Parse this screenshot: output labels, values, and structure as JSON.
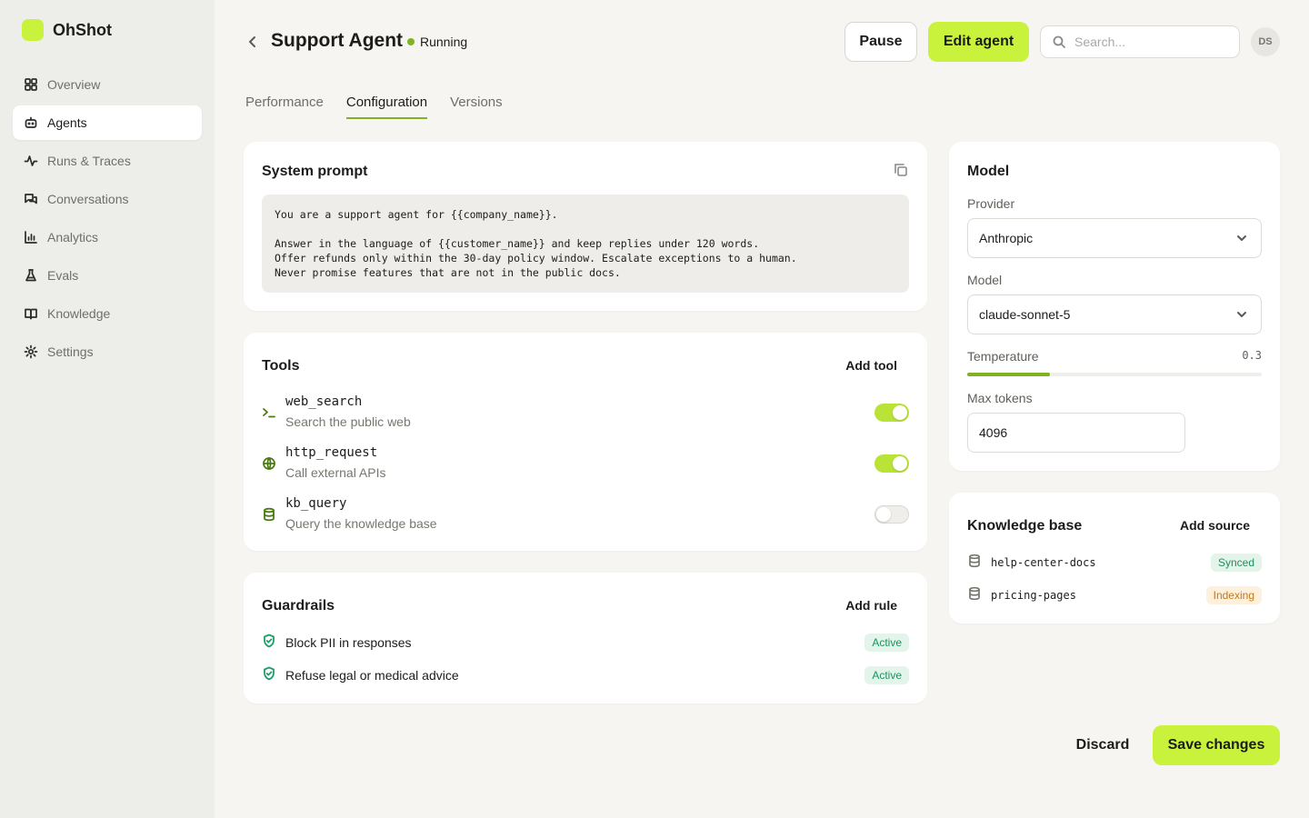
{
  "app": {
    "name": "OhShot"
  },
  "sidebar": {
    "items": [
      {
        "label": "Overview",
        "icon": "grid-icon",
        "active": false
      },
      {
        "label": "Agents",
        "icon": "bot-icon",
        "active": true
      },
      {
        "label": "Runs & Traces",
        "icon": "activity-icon",
        "active": false
      },
      {
        "label": "Conversations",
        "icon": "chat-icon",
        "active": false
      },
      {
        "label": "Analytics",
        "icon": "bar-chart-icon",
        "active": false
      },
      {
        "label": "Evals",
        "icon": "flask-icon",
        "active": false
      },
      {
        "label": "Knowledge",
        "icon": "book-icon",
        "active": false
      },
      {
        "label": "Settings",
        "icon": "gear-icon",
        "active": false
      }
    ]
  },
  "header": {
    "title": "Support Agent",
    "status": "Running",
    "pause_label": "Pause",
    "edit_label": "Edit agent",
    "search_placeholder": "Search...",
    "avatar_initials": "DS"
  },
  "tabs": [
    {
      "label": "Performance",
      "active": false
    },
    {
      "label": "Configuration",
      "active": true
    },
    {
      "label": "Versions",
      "active": false
    }
  ],
  "system_prompt": {
    "title": "System prompt",
    "lines": [
      "You are a support agent for {{company_name}}.",
      "",
      "Answer in the language of {{customer_name}} and keep replies under 120 words.",
      "Offer refunds only within the 30-day policy window. Escalate exceptions to a human.",
      "Never promise features that are not in the public docs."
    ]
  },
  "tools": {
    "title": "Tools",
    "add_label": "Add tool",
    "items": [
      {
        "name": "web_search",
        "description": "Search the public web",
        "icon": "terminal-icon",
        "enabled": true
      },
      {
        "name": "http_request",
        "description": "Call external APIs",
        "icon": "globe-icon",
        "enabled": true
      },
      {
        "name": "kb_query",
        "description": "Query the knowledge base",
        "icon": "database-icon",
        "enabled": false
      }
    ]
  },
  "guardrails": {
    "title": "Guardrails",
    "add_label": "Add rule",
    "items": [
      {
        "label": "Block PII in responses",
        "status": "Active"
      },
      {
        "label": "Refuse legal or medical advice",
        "status": "Active"
      }
    ]
  },
  "model": {
    "title": "Model",
    "provider_label": "Provider",
    "provider_value": "Anthropic",
    "model_label": "Model",
    "model_value": "claude-sonnet-5",
    "temperature_label": "Temperature",
    "temperature_value": "0.3",
    "temperature_fraction": 0.28,
    "max_tokens_label": "Max tokens",
    "max_tokens_value": "4096"
  },
  "knowledge_base": {
    "title": "Knowledge base",
    "add_label": "Add source",
    "items": [
      {
        "name": "help-center-docs",
        "status": "Synced",
        "status_color": "#1f8f5f"
      },
      {
        "name": "pricing-pages",
        "status": "Indexing",
        "status_color": "#c07a1a"
      }
    ]
  },
  "footer": {
    "discard_label": "Discard",
    "save_label": "Save changes"
  },
  "colors": {
    "accent": "#c9f23c",
    "accent_dark": "#7fb321",
    "background": "#f6f5f2"
  }
}
